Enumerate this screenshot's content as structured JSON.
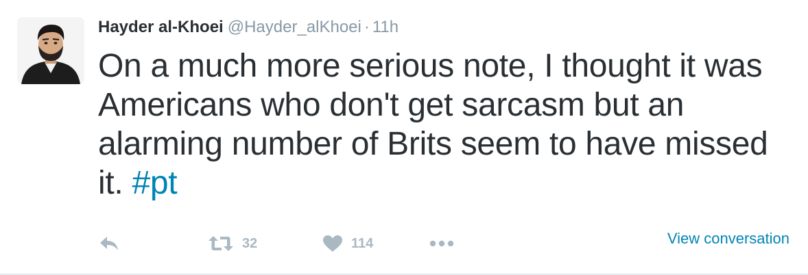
{
  "tweet": {
    "author": {
      "name": "Hayder al-Khoei",
      "handle": "@Hayder_alKhoei",
      "avatar_icon": "profile-photo-icon"
    },
    "separator": "·",
    "timestamp": "11h",
    "text_main": "On a much more serious note, I thought it was Americans who don't get sarcasm but an alarming number of Brits seem to have missed it. ",
    "hashtag": "#pt",
    "actions": {
      "reply_icon": "reply-icon",
      "retweet_icon": "retweet-icon",
      "retweet_count": "32",
      "like_icon": "heart-icon",
      "like_count": "114",
      "more_icon": "more-dots-icon"
    },
    "view_conversation": "View conversation"
  },
  "colors": {
    "text": "#292f33",
    "muted": "#8899a6",
    "icon": "#aab8c2",
    "link": "#0084b4"
  }
}
